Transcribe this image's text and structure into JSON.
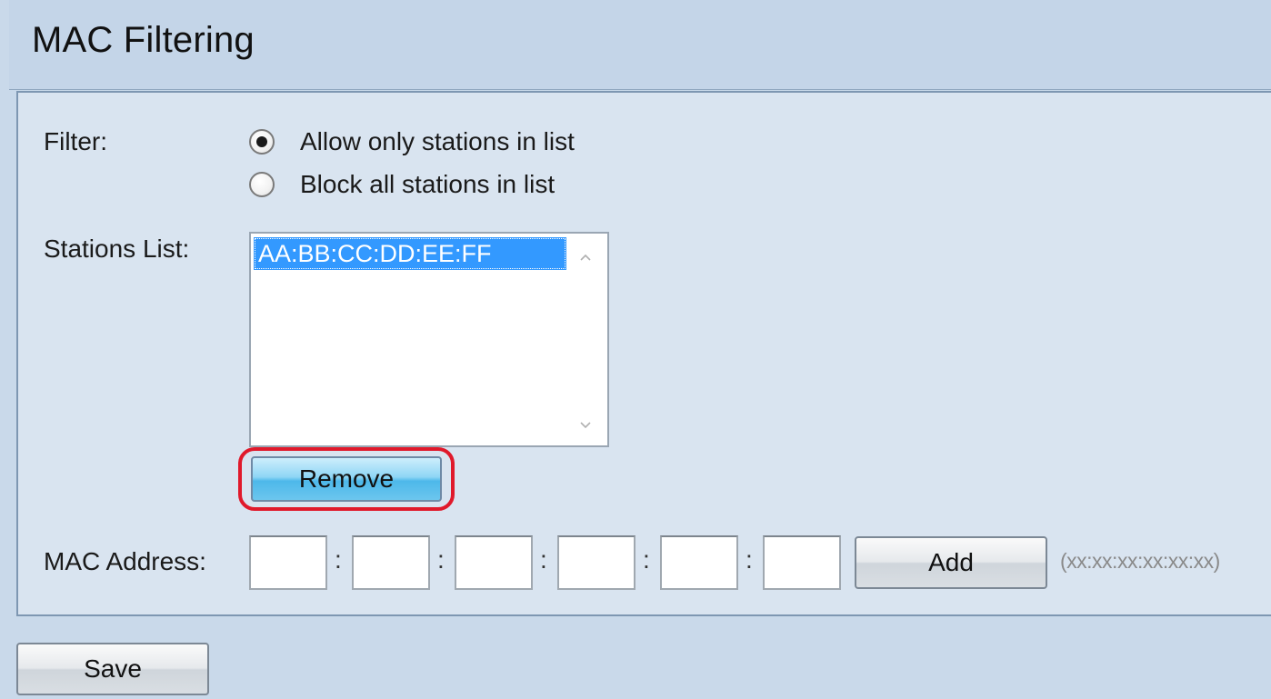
{
  "title": "MAC Filtering",
  "filter": {
    "label": "Filter:",
    "options": [
      {
        "label": "Allow only stations in list",
        "selected": true
      },
      {
        "label": "Block all stations in list",
        "selected": false
      }
    ]
  },
  "stations": {
    "label": "Stations List:",
    "items": [
      "AA:BB:CC:DD:EE:FF"
    ],
    "remove_label": "Remove"
  },
  "mac": {
    "label": "MAC Address:",
    "separator": ":",
    "fields": [
      "",
      "",
      "",
      "",
      "",
      ""
    ],
    "add_label": "Add",
    "hint": "(xx:xx:xx:xx:xx:xx)"
  },
  "save_label": "Save",
  "colors": {
    "highlight": "#e0192b",
    "selection": "#3399ff",
    "remove_button": "#4db8ea"
  }
}
